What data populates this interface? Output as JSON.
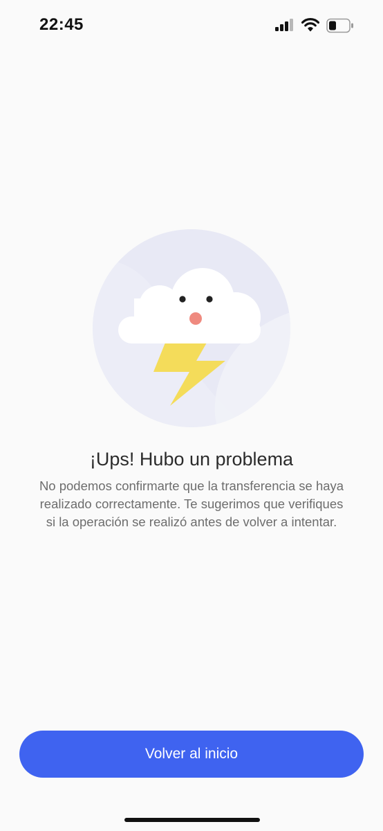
{
  "status_bar": {
    "time": "22:45",
    "icons": [
      "cellular-signal-icon",
      "wifi-icon",
      "battery-icon"
    ]
  },
  "illustration": {
    "icon": "storm-cloud-icon",
    "circle_color": "#e8e9f5",
    "lightning_color": "#f4dc5a",
    "mouth_color": "#ef8a7f"
  },
  "error": {
    "title": "¡Ups! Hubo un problema",
    "message": "No podemos confirmarte que la transferencia se haya realizado correctamente. Te sugerimos que verifiques si la operación se realizó antes de volver a intentar."
  },
  "actions": {
    "back_home_label": "Volver al inicio",
    "button_color": "#3f63f0"
  }
}
